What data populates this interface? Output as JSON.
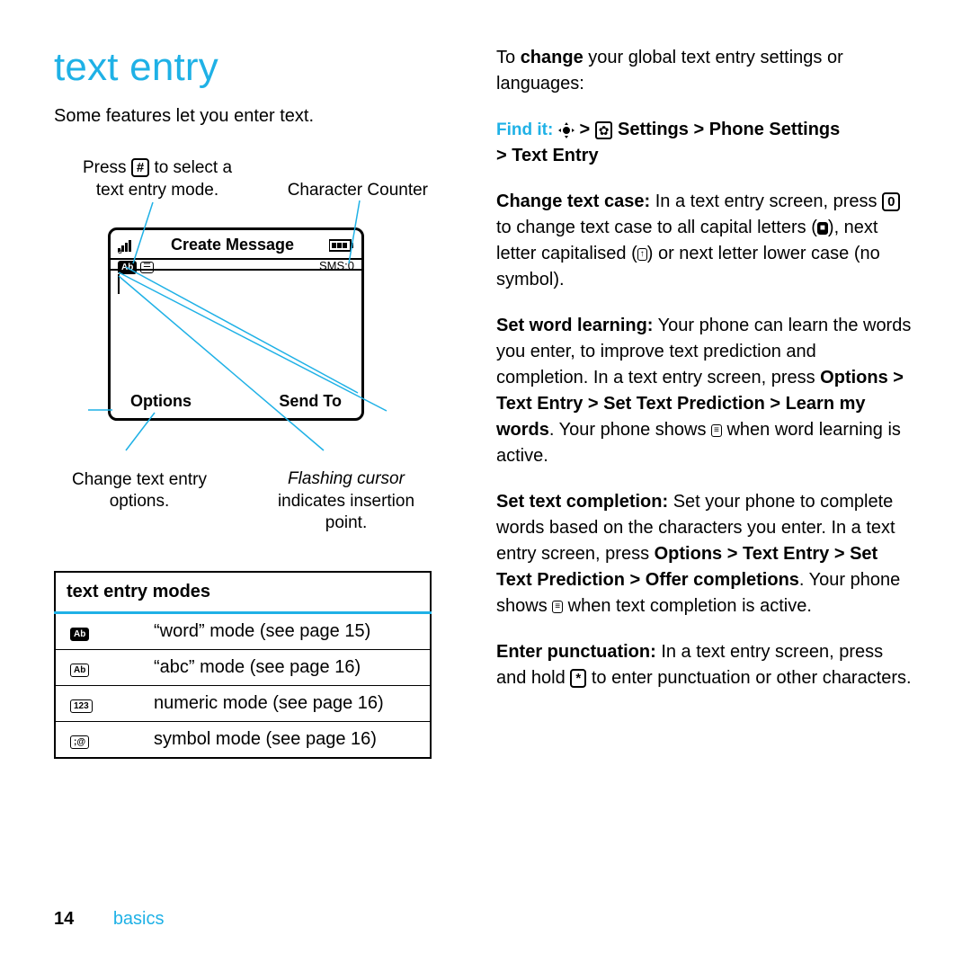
{
  "heading": "text entry",
  "intro": "Some features let you enter text.",
  "callouts": {
    "top_left_a": "Press",
    "hash_key": "#",
    "top_left_b": "to select a",
    "top_left_c": "text entry mode.",
    "top_right": "Character Counter",
    "bottom_left_a": "Change text entry",
    "bottom_left_b": "options.",
    "bottom_right_a": "Flashing cursor",
    "bottom_right_b": "indicates insertion",
    "bottom_right_c": "point."
  },
  "phone": {
    "title": "Create Message",
    "sms": "SMS:0",
    "sub_icon1": "Ab",
    "options": "Options",
    "sendto": "Send To"
  },
  "modes_table": {
    "header": "text entry modes",
    "rows": [
      {
        "icon": "Ab",
        "fill": true,
        "text": "“word” mode (see page 15)"
      },
      {
        "icon": "Ab",
        "fill": false,
        "text": "“abc” mode (see page 16)"
      },
      {
        "icon": "123",
        "fill": false,
        "text": "numeric mode (see page 16)"
      },
      {
        "icon": ";@",
        "fill": false,
        "text": "symbol mode (see page 16)"
      }
    ]
  },
  "right": {
    "p1a": "To ",
    "p1b": "change",
    "p1c": " your global text entry settings or languages:",
    "findit_label": "Find it:",
    "findit_path1": "Settings",
    "findit_path2": "Phone Settings",
    "findit_path3": "Text Entry",
    "gt": ">",
    "p2_lead": "Change text case:",
    "p2a": " In a text entry screen, press ",
    "zero_key": "0",
    "p2b": " to change text case to all capital letters (",
    "p2c": "), next letter capitalised (",
    "p2d": ") or next letter lower case (no symbol).",
    "cap_all": "■",
    "cap_next": "↑",
    "p3_lead": "Set word learning:",
    "p3a": " Your phone can learn the words you enter, to improve text prediction and completion. In a text entry screen, press ",
    "options_word": "Options",
    "p3_path": "Text Entry > Set Text Prediction > Learn my words",
    "p3b": ". Your phone shows ",
    "p3c": " when word learning is active.",
    "learn_icon": "≡",
    "p4_lead": "Set text completion:",
    "p4a": " Set your phone to complete words based on the characters you enter. In a text entry screen, press ",
    "p4_path": "Text Entry > Set Text Prediction > Offer completions",
    "p4b": ". Your phone shows ",
    "p4c": " when text completion is active.",
    "p5_lead": "Enter punctuation:",
    "p5a": " In a text entry screen, press and hold ",
    "star_key": "*",
    "p5b": " to enter punctuation or other characters."
  },
  "footer": {
    "page": "14",
    "section": "basics"
  }
}
